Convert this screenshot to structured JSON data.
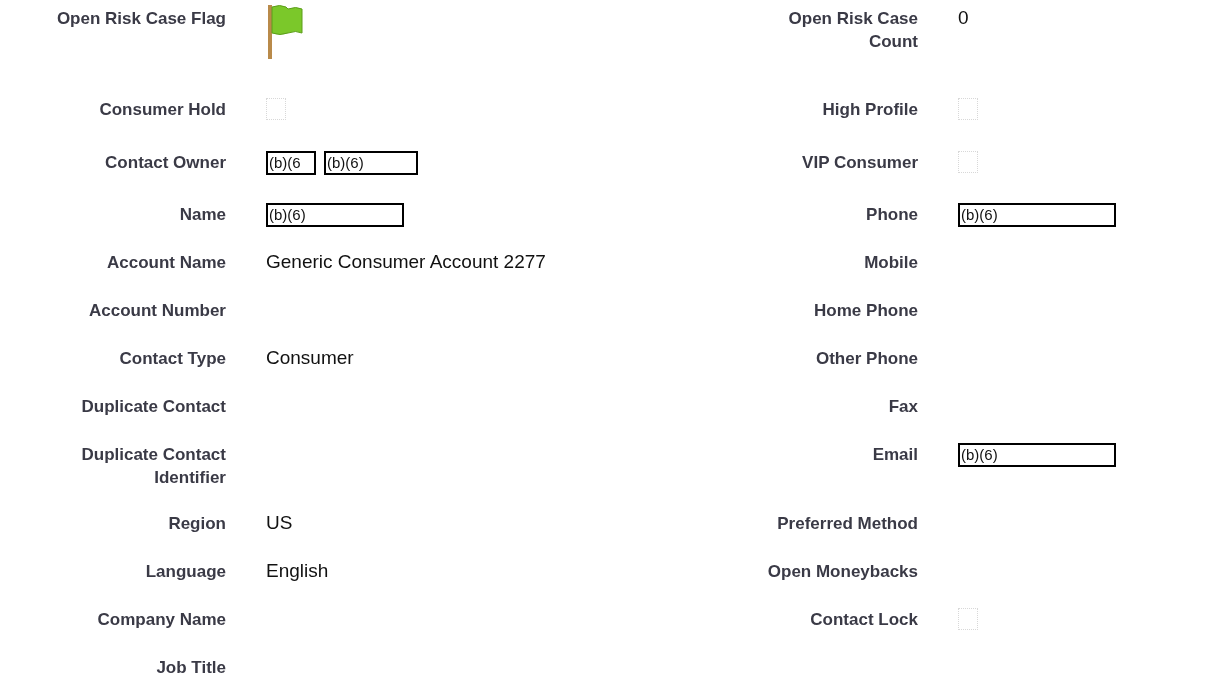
{
  "rows": [
    {
      "left": {
        "label": "Open Risk Case Flag",
        "kind": "flag"
      },
      "right": {
        "label": "Open Risk Case Count",
        "kind": "text",
        "value": "0"
      }
    },
    {
      "left": {
        "label": "Consumer Hold",
        "kind": "checkbox",
        "checked": false
      },
      "right": {
        "label": "High Profile",
        "kind": "checkbox",
        "checked": false
      }
    },
    {
      "left": {
        "label": "Contact Owner",
        "kind": "redacted",
        "values": [
          "(b)(6",
          "(b)(6)"
        ]
      },
      "right": {
        "label": "VIP Consumer",
        "kind": "checkbox",
        "checked": false
      }
    },
    {
      "left": {
        "label": "Name",
        "kind": "redacted",
        "values": [
          "(b)(6)"
        ]
      },
      "right": {
        "label": "Phone",
        "kind": "redacted",
        "values": [
          "(b)(6)"
        ]
      }
    },
    {
      "left": {
        "label": "Account Name",
        "kind": "text",
        "value": "Generic Consumer Account 2277"
      },
      "right": {
        "label": "Mobile",
        "kind": "empty"
      }
    },
    {
      "left": {
        "label": "Account Number",
        "kind": "empty"
      },
      "right": {
        "label": "Home Phone",
        "kind": "empty"
      }
    },
    {
      "left": {
        "label": "Contact Type",
        "kind": "text",
        "value": "Consumer"
      },
      "right": {
        "label": "Other Phone",
        "kind": "empty"
      }
    },
    {
      "left": {
        "label": "Duplicate Contact",
        "kind": "empty"
      },
      "right": {
        "label": "Fax",
        "kind": "empty"
      }
    },
    {
      "left": {
        "label": "Duplicate Contact Identifier",
        "kind": "empty"
      },
      "right": {
        "label": "Email",
        "kind": "redacted",
        "values": [
          "(b)(6)"
        ]
      }
    },
    {
      "left": {
        "label": "Region",
        "kind": "text",
        "value": "US"
      },
      "right": {
        "label": "Preferred Method",
        "kind": "empty"
      }
    },
    {
      "left": {
        "label": "Language",
        "kind": "text",
        "value": "English"
      },
      "right": {
        "label": "Open Moneybacks",
        "kind": "empty"
      }
    },
    {
      "left": {
        "label": "Company Name",
        "kind": "empty"
      },
      "right": {
        "label": "Contact Lock",
        "kind": "checkbox",
        "checked": false
      }
    },
    {
      "left": {
        "label": "Job Title",
        "kind": "empty"
      }
    }
  ]
}
